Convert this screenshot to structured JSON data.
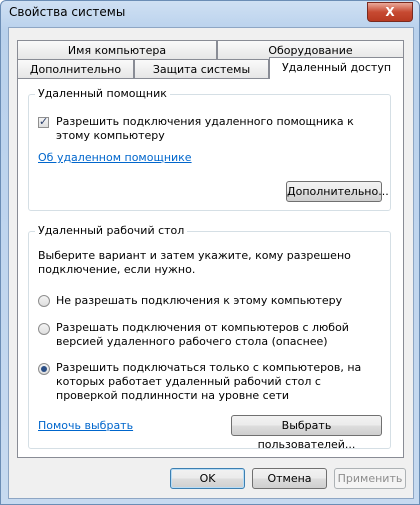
{
  "window": {
    "title": "Свойства системы",
    "close_glyph": "X"
  },
  "tabs": {
    "row1": [
      {
        "label": "Имя компьютера"
      },
      {
        "label": "Оборудование"
      }
    ],
    "row2": [
      {
        "label": "Дополнительно"
      },
      {
        "label": "Защита системы"
      },
      {
        "label": "Удаленный доступ",
        "active": true
      }
    ]
  },
  "remote_assistance": {
    "group_label": "Удаленный помощник",
    "allow_checkbox_label": "Разрешить подключения удаленного помощника к этому компьютеру",
    "allow_checked": true,
    "about_link": "Об удаленном помощнике",
    "advanced_button": "Дополнительно..."
  },
  "remote_desktop": {
    "group_label": "Удаленный рабочий стол",
    "instructions": "Выберите вариант и затем укажите, кому разрешено подключение, если нужно.",
    "options": [
      {
        "label": "Не разрешать подключения к этому компьютеру",
        "selected": false
      },
      {
        "label": "Разрешать подключения от компьютеров с любой версией удаленного рабочего стола (опаснее)",
        "selected": false
      },
      {
        "label": "Разрешить подключаться только с компьютеров, на которых работает удаленный рабочий стол с проверкой подлинности на уровне сети",
        "selected": true
      }
    ],
    "help_link": "Помочь выбрать",
    "select_users_button": "Выбрать пользователей..."
  },
  "footer": {
    "ok": "OK",
    "cancel": "Отмена",
    "apply": "Применить"
  }
}
